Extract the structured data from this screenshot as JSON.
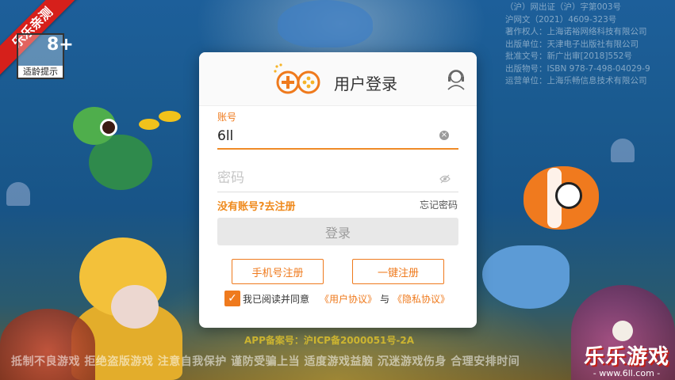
{
  "corner_ribbon": {
    "text": "乐乐亲测"
  },
  "age_rating": {
    "number": "8+",
    "caption": "适龄提示"
  },
  "publisher_info": [
    "（沪）网出证（沪）字第003号",
    "沪网文（2021）4609-323号",
    "著作权人：上海诺裕网络科技有限公司",
    "出版单位：天津电子出版社有限公司",
    "批准文号：新广出审[2018]552号",
    "出版物号：ISBN 978-7-498-04029-9",
    "运营单位：上海乐畅信息技术有限公司"
  ],
  "login_dialog": {
    "title": "用户登录",
    "logo_icon": "gamepad-logo-icon",
    "service_icon": "customer-service-icon",
    "account_label": "账号",
    "account_value": "6ll",
    "clear_icon": "clear-icon",
    "password_placeholder": "密码",
    "password_value": "",
    "eye_icon": "eye-icon",
    "register_link": "没有账号?去注册",
    "forgot_link": "忘记密码",
    "login_button": "登录",
    "phone_register_button": "手机号注册",
    "quick_register_button": "一键注册",
    "agree_checked": true,
    "agree_text": "我已阅读并同意",
    "user_agreement": "《用户协议》",
    "and_text": "与",
    "privacy_agreement": "《隐私协议》"
  },
  "icp_text": "APP备案号：沪ICP备2000051号-2A",
  "health_notice": "抵制不良游戏 拒绝盗版游戏 注意自我保护 谨防受骗上当 适度游戏益脑 沉迷游戏伤身 合理安排时间",
  "brand": {
    "title": "乐乐游戏",
    "url": "- www.6ll.com -"
  },
  "colors": {
    "accent": "#ef7a1d",
    "ribbon": "#d6201b",
    "dialog_bg": "#ffffff"
  }
}
